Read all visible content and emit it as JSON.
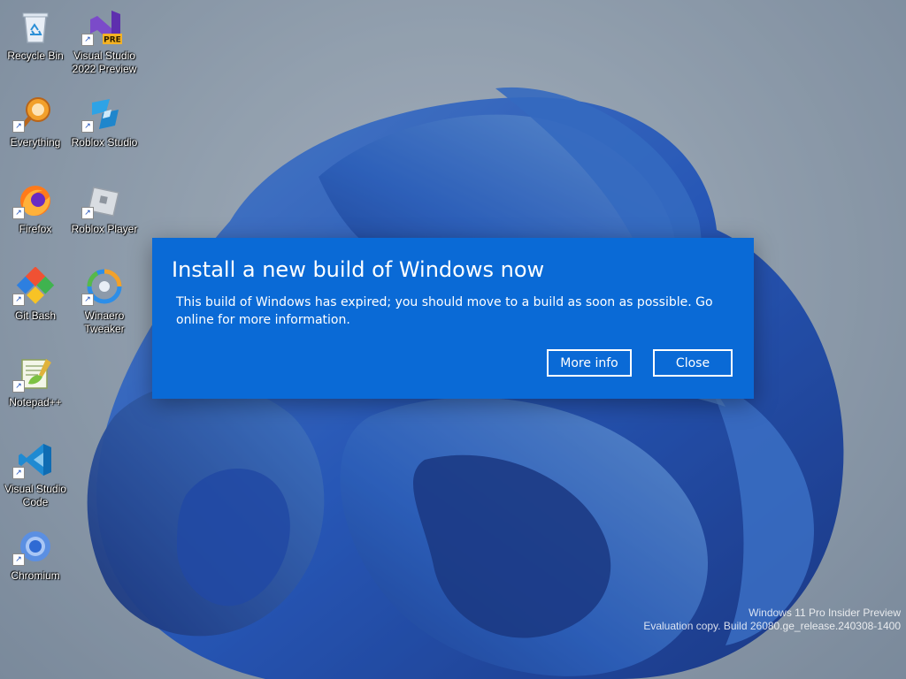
{
  "desktop": {
    "icons": [
      {
        "label": "Recycle Bin",
        "icon": "recycle-bin-icon"
      },
      {
        "label": "Visual Studio 2022 Preview",
        "icon": "visual-studio-preview-icon",
        "badge": "PRE"
      },
      {
        "label": "Everything",
        "icon": "everything-search-icon"
      },
      {
        "label": "Roblox Studio",
        "icon": "roblox-studio-icon"
      },
      {
        "label": "Firefox",
        "icon": "firefox-icon"
      },
      {
        "label": "Roblox Player",
        "icon": "roblox-player-icon"
      },
      {
        "label": "Git Bash",
        "icon": "git-bash-icon"
      },
      {
        "label": "Winaero Tweaker",
        "icon": "winaero-tweaker-icon"
      },
      {
        "label": "Notepad++",
        "icon": "notepad-plus-plus-icon"
      },
      {
        "label": "Visual Studio Code",
        "icon": "vscode-icon"
      },
      {
        "label": "Chromium",
        "icon": "chromium-icon"
      }
    ],
    "shortcut_arrow": "↗"
  },
  "dialog": {
    "title": "Install a new build of Windows now",
    "body": "This build of Windows has expired; you should move to a build as soon as possible. Go online for more information.",
    "more_info_label": "More info",
    "close_label": "Close",
    "background_color": "#0a6ad6"
  },
  "watermark": {
    "line1": "Windows 11 Pro Insider Preview",
    "line2": "Evaluation copy. Build 26080.ge_release.240308-1400"
  }
}
